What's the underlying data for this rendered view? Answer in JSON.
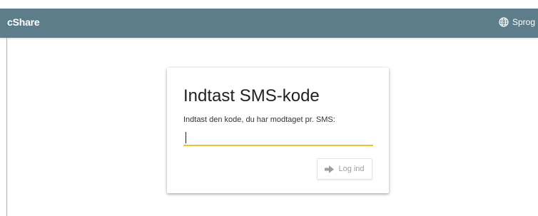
{
  "header": {
    "brand": "cShare",
    "language_label": "Sprog",
    "language_icon": "globe-icon"
  },
  "card": {
    "title": "Indtast SMS-kode",
    "label": "Indtast den kode, du har modtaget pr. SMS:",
    "input_value": "",
    "login_label": "Log ind",
    "login_icon": "arrow-right-icon"
  },
  "colors": {
    "appbar": "#5e7d8a",
    "input_underline": "#f2c12e",
    "button_text": "#9e9e9e"
  }
}
